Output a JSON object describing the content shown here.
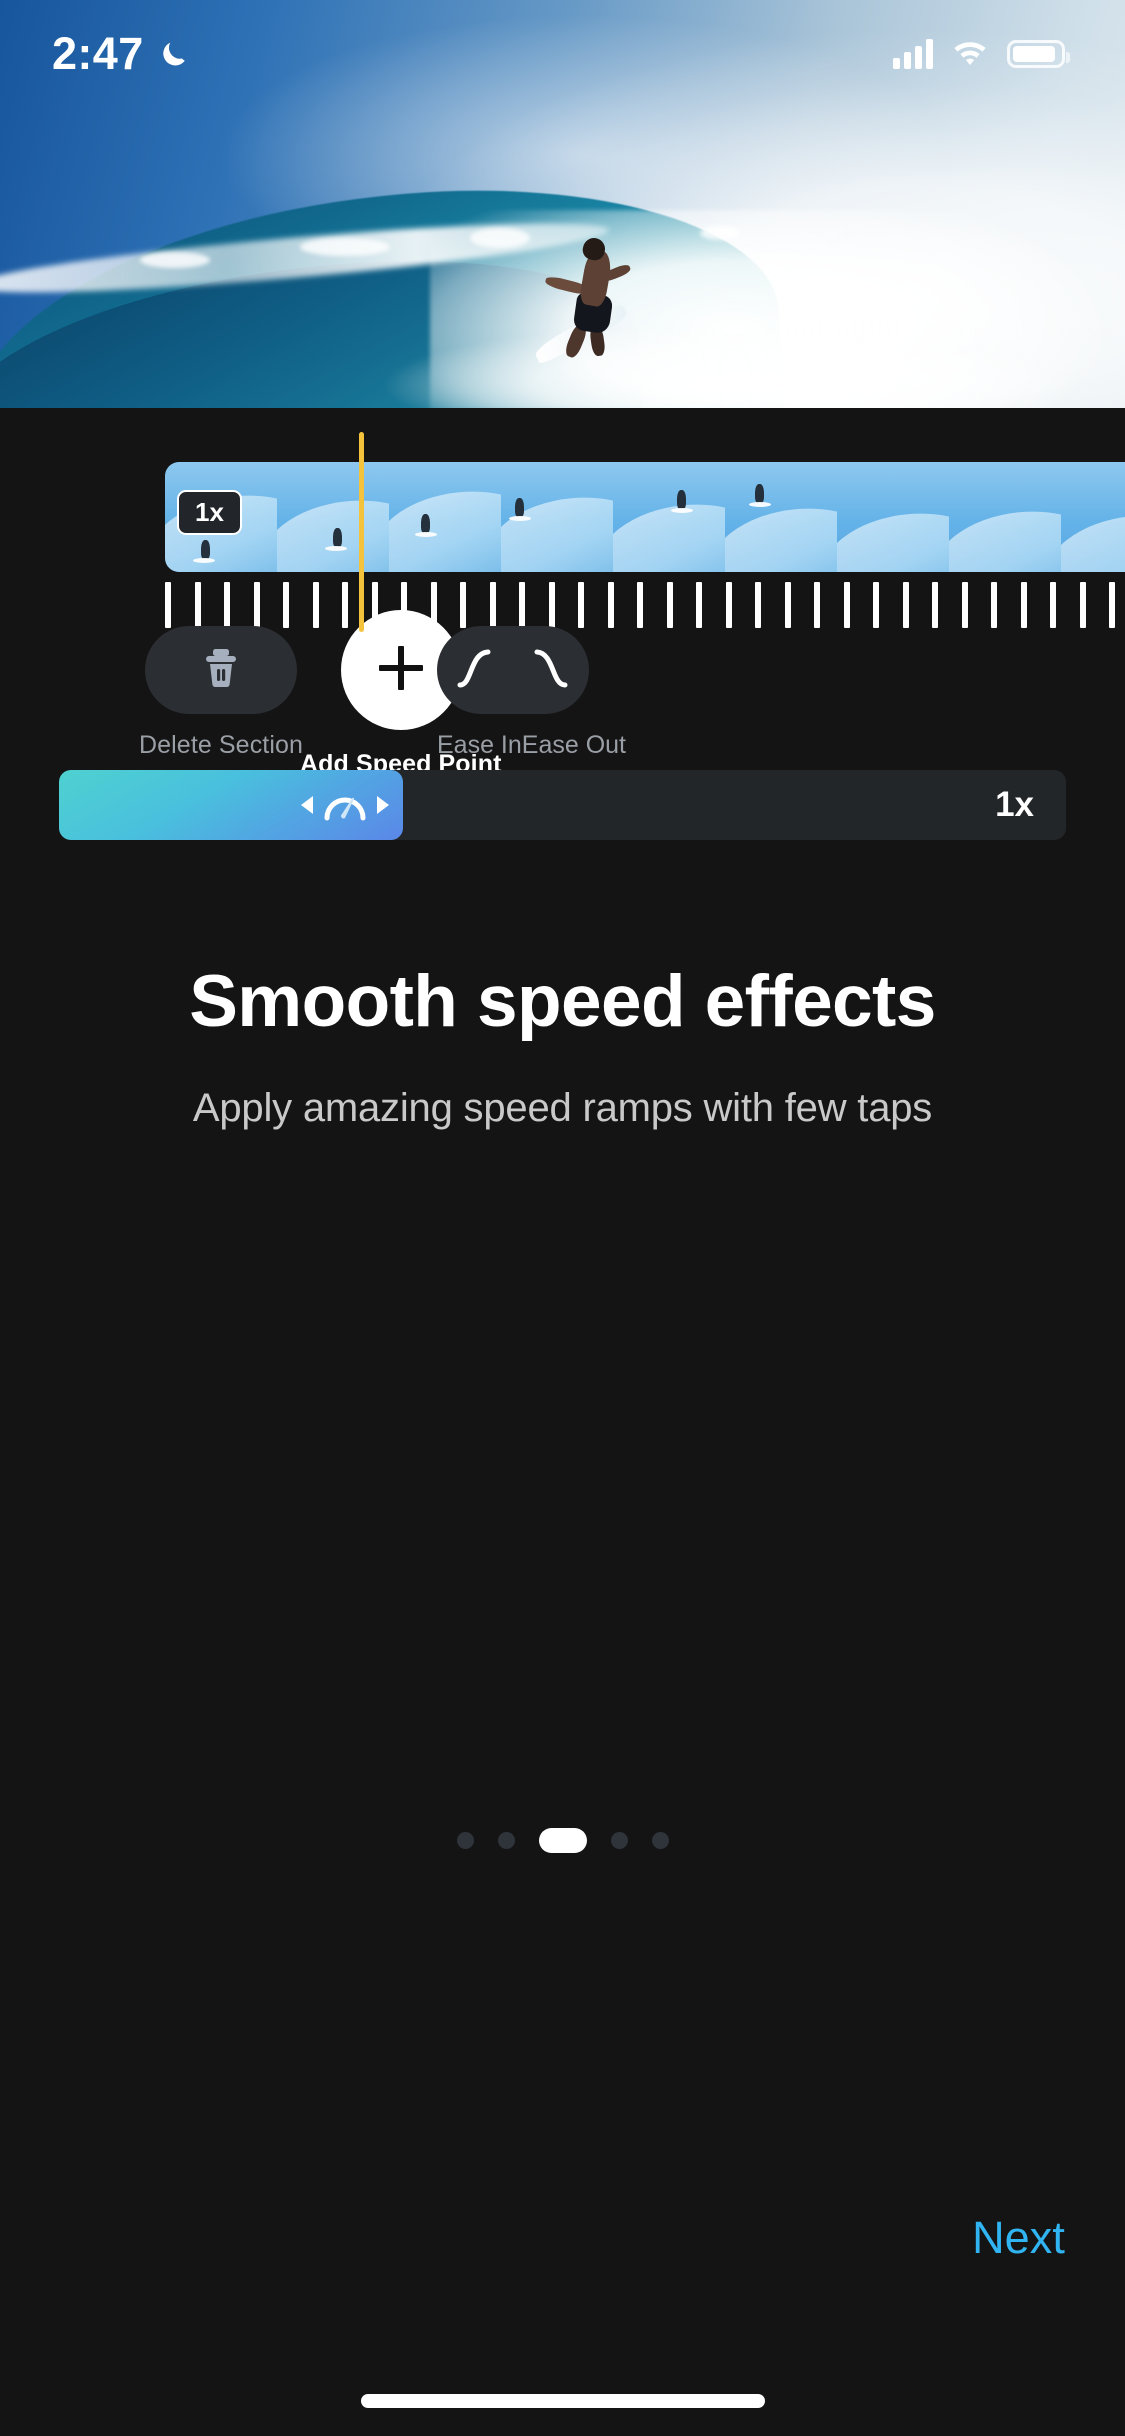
{
  "status_bar": {
    "time": "2:47",
    "dnd_icon": "moon-icon",
    "signal_icon": "cellular-signal-icon",
    "wifi_icon": "wifi-icon",
    "battery_icon": "battery-icon"
  },
  "preview": {
    "description": "surfer-riding-wave-video-preview"
  },
  "timeline": {
    "speed_badge": "1x",
    "playhead_label": "playhead",
    "frame_count": 9,
    "tick_count": 34
  },
  "controls": {
    "delete": {
      "label": "Delete Section",
      "icon": "trash-icon"
    },
    "add": {
      "label": "Add Speed Point",
      "icon": "plus-icon"
    },
    "ease_in": {
      "label": "Ease In",
      "icon": "ease-in-curve-icon"
    },
    "ease_out": {
      "label": "Ease Out",
      "icon": "ease-out-curve-icon"
    }
  },
  "speed_slider": {
    "value_label": "1x",
    "handle_icon": "speedometer-icon",
    "decrease_icon": "arrow-left-icon",
    "increase_icon": "arrow-right-icon",
    "fill_percent": 34,
    "fill_gradient_start": "#4fd1d0",
    "fill_gradient_end": "#5b87e8",
    "track_color": "#232629"
  },
  "onboarding": {
    "title": "Smooth speed effects",
    "subtitle": "Apply amazing speed ramps with few taps",
    "page_dots": {
      "total": 5,
      "active_index": 2
    },
    "next_label": "Next",
    "accent_color": "#31b4f2"
  }
}
